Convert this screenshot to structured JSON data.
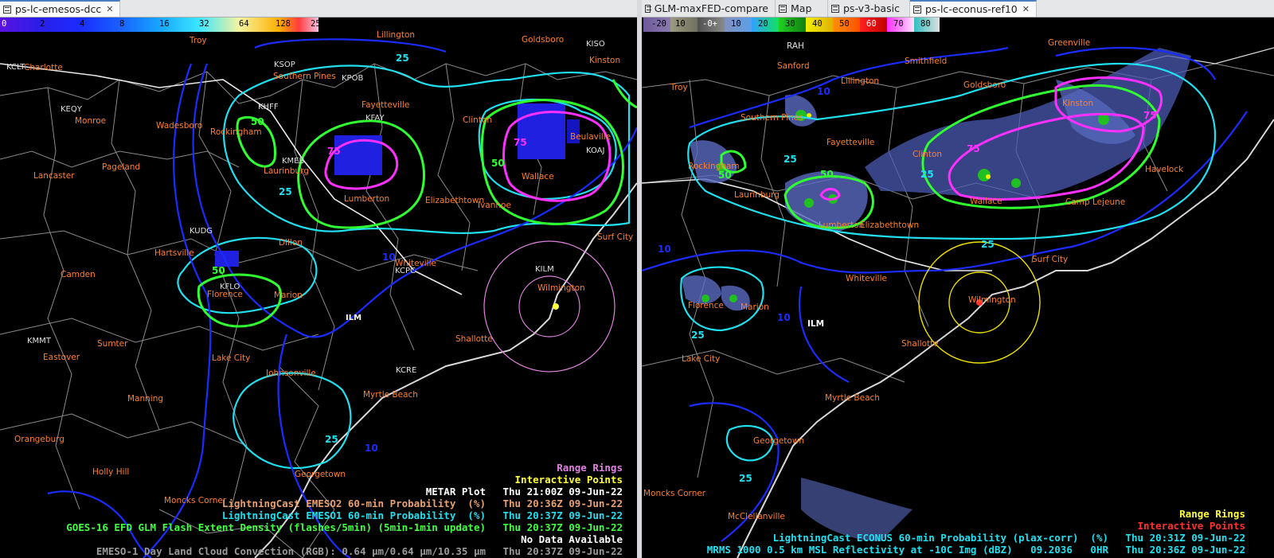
{
  "left_pane": {
    "tabs": [
      {
        "label": "ps-lc-emesos-dcc",
        "active": true,
        "closable": true
      }
    ],
    "colorbar": {
      "ticks": [
        "0",
        "2",
        "4",
        "8",
        "16",
        "32",
        "64",
        "128",
        "256"
      ],
      "colors": [
        "#5a12e0",
        "#2a1ee8",
        "#1a40ff",
        "#17a6ff",
        "#3ce6ff",
        "#f4f4a0",
        "#ffb000",
        "#ff3c3c",
        "#ffffff"
      ]
    },
    "town_labels": [
      "Charlotte",
      "Troy",
      "Lillington",
      "Goldsboro",
      "Kinston",
      "Monroe",
      "Wadesboro",
      "Rockingham",
      "Southern Pines",
      "Fayetteville",
      "Clinton",
      "Beulaville",
      "Lancaster",
      "Pageland",
      "Laurinburg",
      "Lumberton",
      "Elizabethtown",
      "Ivanhoe",
      "Wallace",
      "Hartsville",
      "Dillon",
      "Whiteville",
      "Surf City",
      "Wilmington",
      "Camden",
      "Florence",
      "Marion",
      "Sumter",
      "Lake City",
      "Johnsonville",
      "Myrtle Beach",
      "Shallotte",
      "Manning",
      "Eastover",
      "Orangeburg",
      "Holly Hill",
      "Georgetown",
      "Moncks Corner"
    ],
    "station_ids": [
      "KCLT",
      "KEQY",
      "KSOP",
      "KPOB",
      "KHFF",
      "KFAY",
      "KMEB",
      "KOAJ",
      "KISO",
      "KUDG",
      "KFLO",
      "KCPC",
      "KILM",
      "KMMT",
      "KCRE",
      "ILM"
    ],
    "contour_labels": [
      "25",
      "50",
      "75",
      "10"
    ],
    "legend": [
      {
        "text": "Range Rings",
        "time": "",
        "color": "#e080e0"
      },
      {
        "text": "Interactive Points",
        "time": "",
        "color": "#ffff40"
      },
      {
        "text": "METAR Plot",
        "time": "Thu 21:00Z 09-Jun-22",
        "color": "#ffffff"
      },
      {
        "text": "LightningCast EMESO2 60-min Probability  (%)",
        "time": "Thu 20:36Z 09-Jun-22",
        "color": "#e8a070"
      },
      {
        "text": "LightningCast EMESO1 60-min Probability  (%)",
        "time": "Thu 20:37Z 09-Jun-22",
        "color": "#20e0f0"
      },
      {
        "text": "GOES-16 EFD GLM Flash Extent Density (flashes/5min) (5min-1min update)",
        "time": "Thu 20:37Z 09-Jun-22",
        "color": "#40ff40"
      },
      {
        "text": "No Data Available",
        "time": "",
        "color": "#ffffff"
      },
      {
        "text": "EMESO-1 Day Land Cloud Convection (RGB): 0.64 µm/0.64 µm/10.35 µm",
        "time": "Thu 20:37Z 09-Jun-22",
        "color": "#9a9a9a"
      }
    ]
  },
  "right_pane": {
    "tabs": [
      {
        "label": "GLM-maxFED-compare",
        "active": false,
        "closable": false
      },
      {
        "label": "Map",
        "active": false,
        "closable": false
      },
      {
        "label": "ps-v3-basic",
        "active": false,
        "closable": false
      },
      {
        "label": "ps-lc-econus-ref10",
        "active": true,
        "closable": true
      }
    ],
    "colorbar": {
      "ticks": [
        "-20",
        "10",
        "-0+",
        "10",
        "20",
        "30",
        "40",
        "50",
        "60",
        "70",
        "80"
      ],
      "colors": [
        "#6c5a9a",
        "#8c8a6e",
        "#5a5a5a",
        "#8090c0",
        "#30a0ff",
        "#20d020",
        "#f0f000",
        "#ff9000",
        "#ff2020",
        "#ff30ff",
        "#e0e0e0"
      ]
    },
    "town_labels": [
      "RAH",
      "Troy",
      "Sanford",
      "Smithfield",
      "Greenville",
      "Lillington",
      "Goldsboro",
      "Kinston",
      "Southern Pines",
      "Fayetteville",
      "Clinton",
      "Havelock",
      "Rockingham",
      "Laurinburg",
      "Lumberton",
      "Elizabethtown",
      "Wallace",
      "Camp Lejeune",
      "Whiteville",
      "Surf City",
      "Wilmington",
      "Florence",
      "Marion",
      "ILM",
      "Shallotte",
      "Lake City",
      "Myrtle Beach",
      "Georgetown",
      "Moncks Corner",
      "McClellanville"
    ],
    "contour_labels": [
      "10",
      "25",
      "50",
      "75"
    ],
    "legend": [
      {
        "text": "Range Rings",
        "time": "",
        "color": "#ffff40"
      },
      {
        "text": "Interactive Points",
        "time": "",
        "color": "#ff3030"
      },
      {
        "text": "LightningCast ECONUS 60-min Probability (plax-corr)  (%)",
        "time": "Thu 20:31Z 09-Jun-22",
        "color": "#20e0f0"
      },
      {
        "text": "MRMS 1000 0.5 km MSL Reflectivity at -10C Img (dBZ)   09.2036   0HR",
        "time": "Thu 20:36Z 09-Jun-22",
        "color": "#20e0f0"
      }
    ]
  }
}
